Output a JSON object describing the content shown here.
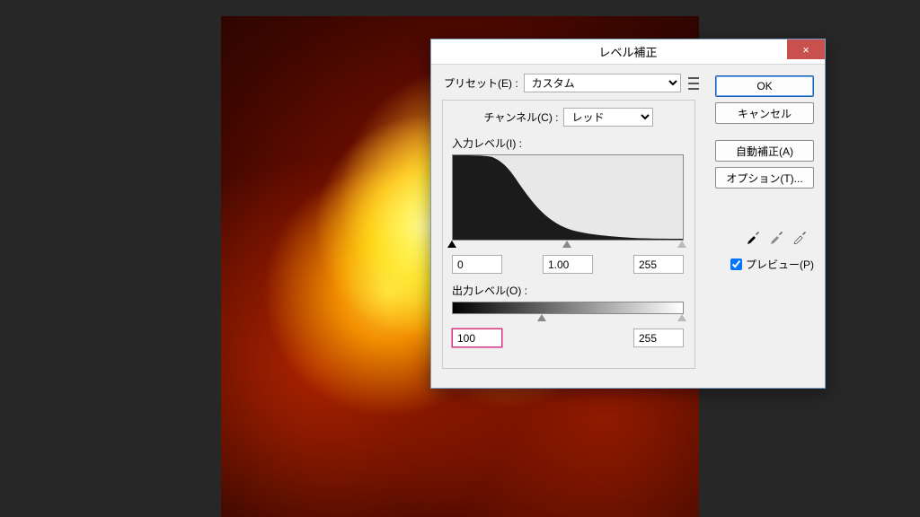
{
  "canvas": {
    "name": "fire-texture"
  },
  "dialog": {
    "title": "レベル補正",
    "close_label": "×",
    "preset": {
      "label": "プリセット(E) :",
      "value": "カスタム"
    },
    "channel": {
      "label": "チャンネル(C) :",
      "value": "レッド"
    },
    "input_levels": {
      "label": "入力レベル(I) :",
      "black": "0",
      "mid": "1.00",
      "white": "255"
    },
    "output_levels": {
      "label": "出力レベル(O) :",
      "black": "100",
      "white": "255"
    },
    "buttons": {
      "ok": "OK",
      "cancel": "キャンセル",
      "auto": "自動補正(A)",
      "options": "オプション(T)..."
    },
    "eyedroppers": {
      "black": "black-point-eyedropper",
      "gray": "gray-point-eyedropper",
      "white": "white-point-eyedropper"
    },
    "preview": {
      "label": "プレビュー(P)",
      "checked": true
    }
  }
}
